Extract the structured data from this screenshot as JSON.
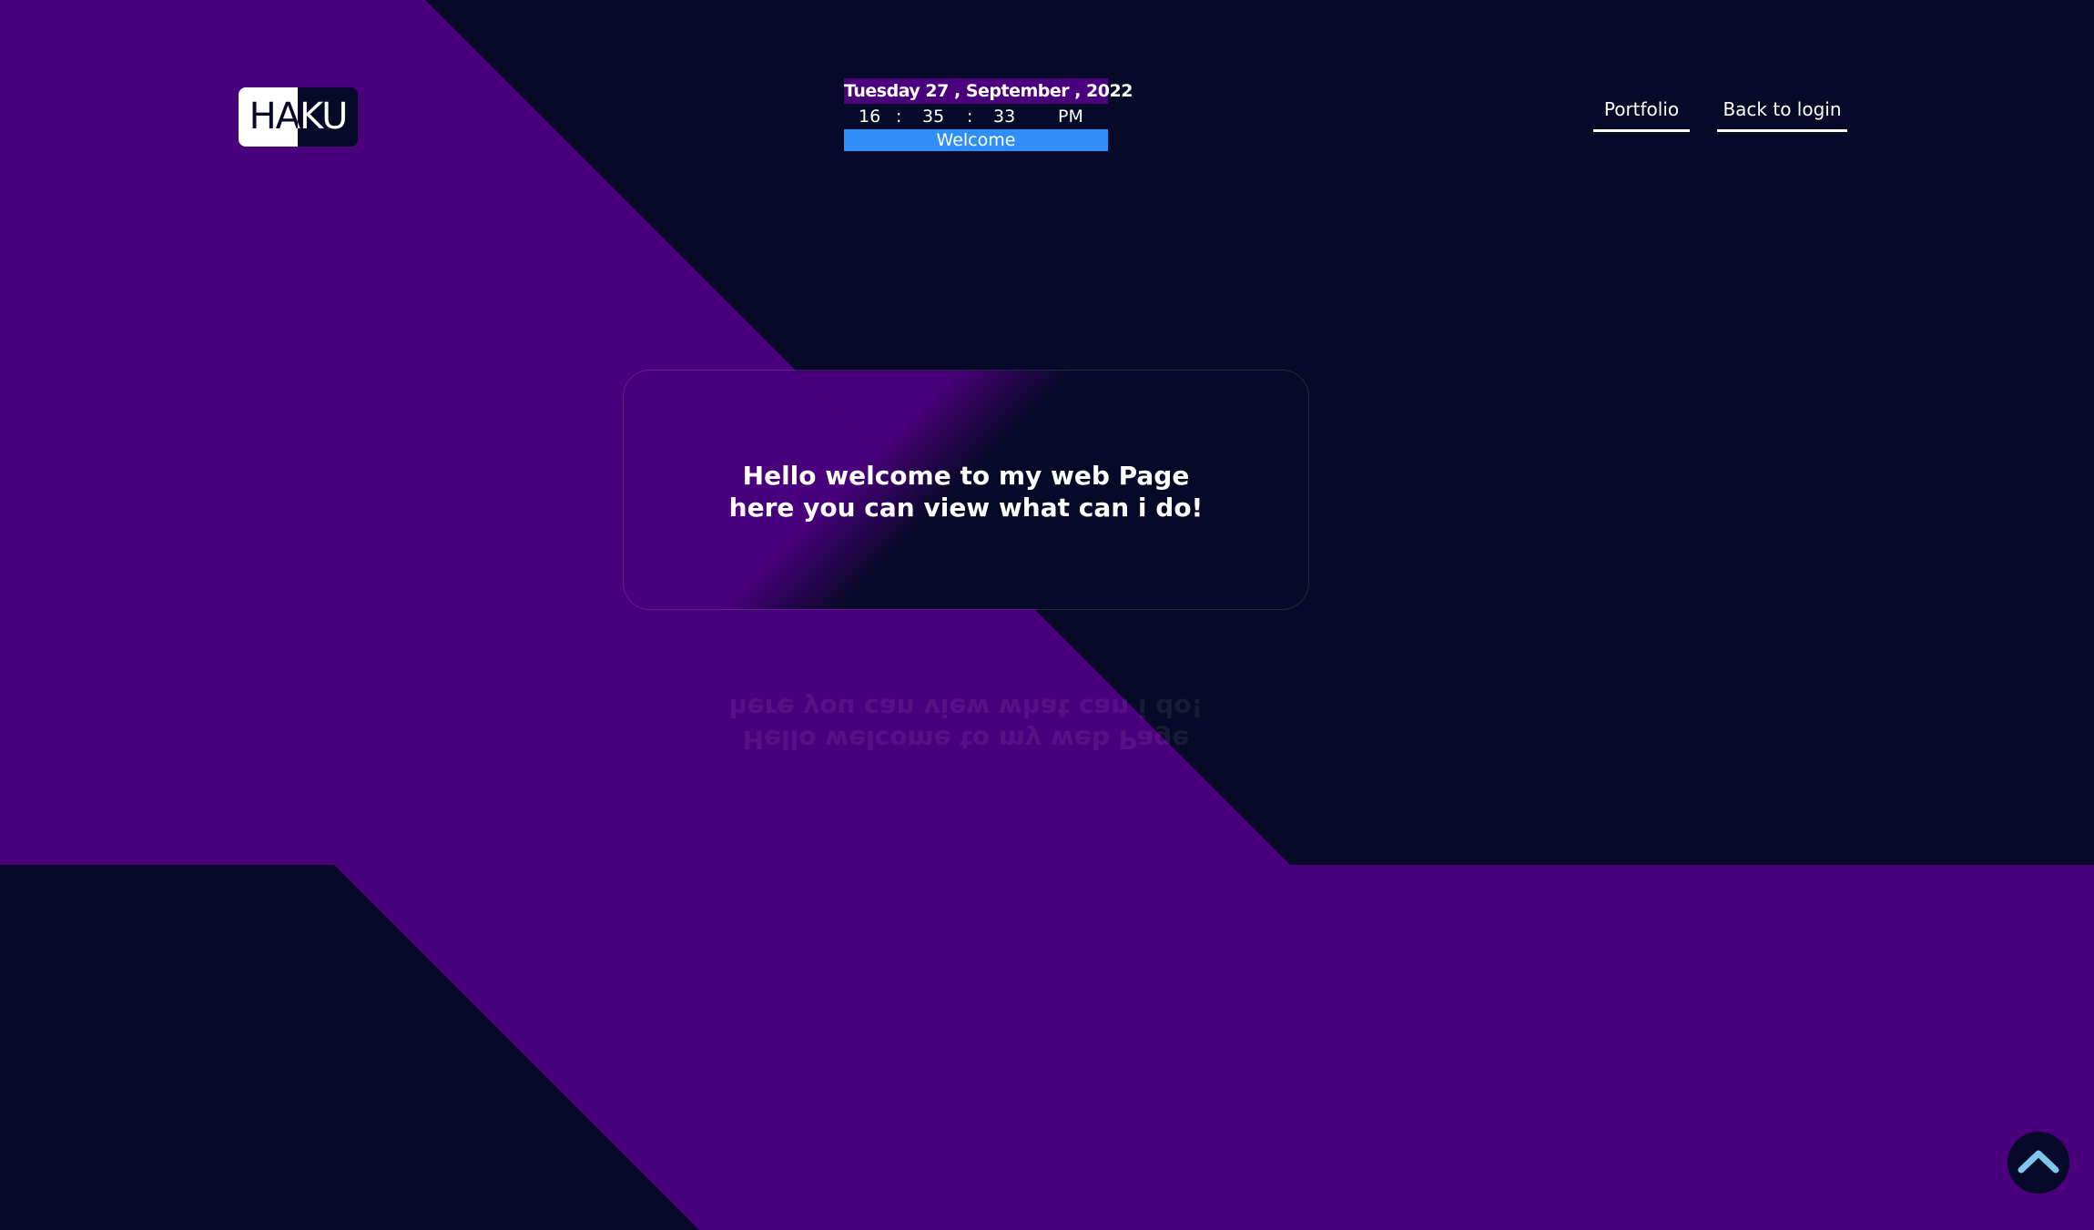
{
  "colors": {
    "purple": "#4a007c",
    "navy": "#070928",
    "accent_blue": "#2d8ff7",
    "arrow": "#7ec8f0",
    "text": "#ffffff"
  },
  "logo": {
    "text": "HAKU"
  },
  "clock": {
    "date": "Tuesday 27 , September , 2022",
    "hours": "16",
    "sep1": ":",
    "minutes": "35",
    "sep2": ":",
    "seconds": "33",
    "period": "PM",
    "welcome": "Welcome"
  },
  "nav": {
    "portfolio": "Portfolio",
    "back_to_login": "Back to login"
  },
  "card": {
    "line1": "Hello welcome to my web Page",
    "line2": "here you can view what can i do!"
  },
  "scroll_top": {
    "icon": "chevron-up-icon"
  }
}
